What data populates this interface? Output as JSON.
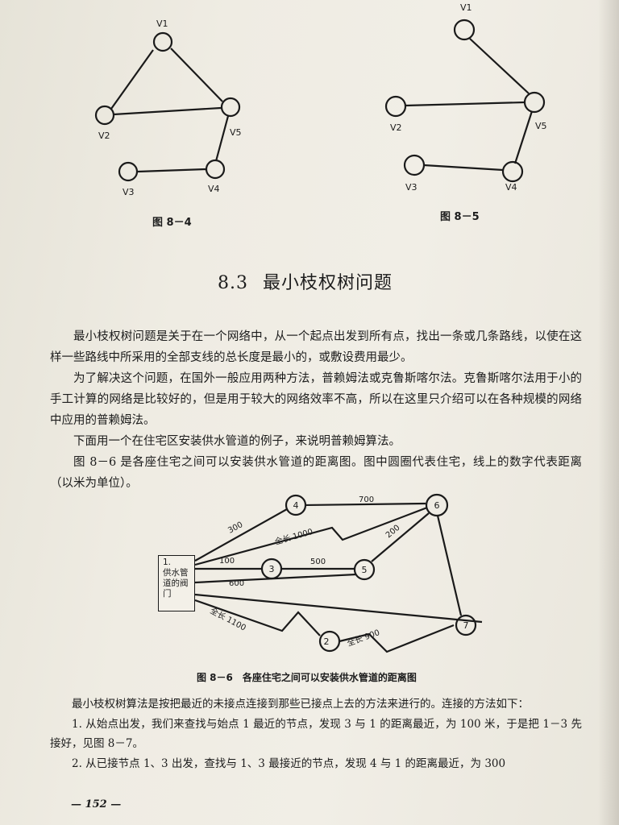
{
  "fig84": {
    "caption": "图 8－4",
    "nodes": [
      {
        "id": "v1",
        "label": "V1"
      },
      {
        "id": "v2",
        "label": "V2"
      },
      {
        "id": "v3",
        "label": "V3"
      },
      {
        "id": "v4",
        "label": "V4"
      },
      {
        "id": "v5",
        "label": "V5"
      }
    ],
    "edges": [
      [
        "v1",
        "v2"
      ],
      [
        "v1",
        "v5"
      ],
      [
        "v2",
        "v5"
      ],
      [
        "v5",
        "v4"
      ],
      [
        "v3",
        "v4"
      ]
    ]
  },
  "fig85": {
    "caption": "图 8－5",
    "nodes": [
      {
        "id": "v1",
        "label": "V1"
      },
      {
        "id": "v2",
        "label": "V2"
      },
      {
        "id": "v3",
        "label": "V3"
      },
      {
        "id": "v4",
        "label": "V4"
      },
      {
        "id": "v5",
        "label": "V5"
      }
    ],
    "edges": [
      [
        "v1",
        "v5"
      ],
      [
        "v2",
        "v5"
      ],
      [
        "v5",
        "v4"
      ],
      [
        "v3",
        "v4"
      ]
    ]
  },
  "section": {
    "number": "8.3",
    "title": "最小枝权树问题"
  },
  "paragraphs": [
    "最小枝权树问题是关于在一个网络中，从一个起点出发到所有点，找出一条或几条路线，以使在这样一些路线中所采用的全部支线的总长度是最小的，或敷设费用最少。",
    "为了解决这个问题，在国外一般应用两种方法，普赖姆法或克鲁斯喀尔法。克鲁斯喀尔法用于小的手工计算的网络是比较好的，但是用于较大的网络效率不高，所以在这里只介绍可以在各种规模的网络中应用的普赖姆法。",
    "下面用一个在住宅区安装供水管道的例子，来说明普赖姆算法。",
    "图 8－6 是各座住宅之间可以安装供水管道的距离图。图中圆圈代表住宅，线上的数字代表距离（以米为单位）。"
  ],
  "fig86": {
    "caption": "图 8－6　各座住宅之间可以安装供水管道的距离图",
    "valve_lines": [
      "1.",
      "供水管",
      "道的阀",
      "门"
    ],
    "nodes": [
      {
        "id": "n2",
        "label": "2"
      },
      {
        "id": "n3",
        "label": "3"
      },
      {
        "id": "n4",
        "label": "4"
      },
      {
        "id": "n5",
        "label": "5"
      },
      {
        "id": "n6",
        "label": "6"
      },
      {
        "id": "n7",
        "label": "7"
      }
    ],
    "edge_labels": {
      "e1_4": "300",
      "e1_6": "全长 1000",
      "e1_3": "100",
      "e3_5": "500",
      "e1_5": "600",
      "e4_6": "700",
      "e5_6": "200",
      "e1_2": "全长 1100",
      "e2_7": "全长 900"
    }
  },
  "after_paragraphs": [
    "最小枝权树算法是按把最近的未接点连接到那些已接点上去的方法来进行的。连接的方法如下：",
    "1. 从始点出发，我们来查找与始点 1 最近的节点，发现 3 与 1 的距离最近，为 100 米，于是把 1－3 先接好，见图 8－7。",
    "2. 从已接节点 1、3 出发，查找与 1、3 最接近的节点，发现 4 与 1 的距离最近，为 300"
  ],
  "folio": "— 152 —"
}
